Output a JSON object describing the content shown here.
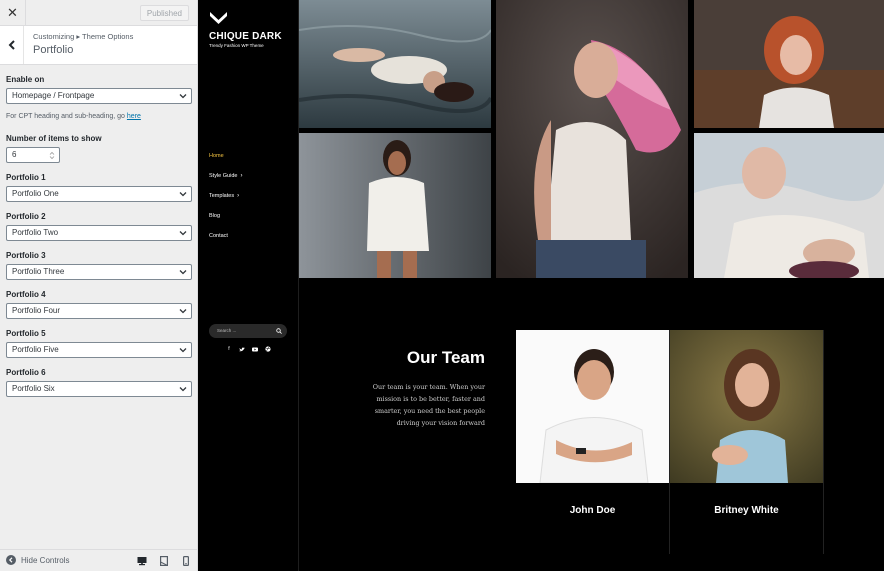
{
  "customizer": {
    "close_icon": "close-icon",
    "published_label": "Published",
    "breadcrumb": "Customizing ▸ Theme Options",
    "section_title": "Portfolio",
    "enable_on": {
      "label": "Enable on",
      "value": "Homepage / Frontpage"
    },
    "help": {
      "text": "For CPT heading and sub-heading, go ",
      "link": "here"
    },
    "items_count": {
      "label": "Number of items to show",
      "value": "6"
    },
    "portfolios": [
      {
        "label": "Portfolio 1",
        "value": "Portfolio One"
      },
      {
        "label": "Portfolio 2",
        "value": "Portfolio Two"
      },
      {
        "label": "Portfolio 3",
        "value": "Portfolio Three"
      },
      {
        "label": "Portfolio 4",
        "value": "Portfolio Four"
      },
      {
        "label": "Portfolio 5",
        "value": "Portfolio Five"
      },
      {
        "label": "Portfolio 6",
        "value": "Portfolio Six"
      }
    ],
    "footer": {
      "hide_controls": "Hide Controls"
    }
  },
  "site": {
    "title": "CHIQUE DARK",
    "tagline": "Trendy Fashion WP Theme",
    "menu": [
      {
        "label": "Home",
        "active": true
      },
      {
        "label": "Style Guide",
        "has_children": true
      },
      {
        "label": "Templates",
        "has_children": true
      },
      {
        "label": "Blog"
      },
      {
        "label": "Contact"
      }
    ],
    "search_placeholder": "Search ...",
    "social_icons": [
      "facebook-icon",
      "twitter-icon",
      "youtube-icon",
      "dribbble-icon"
    ]
  },
  "team": {
    "title": "Our Team",
    "text": "Our team is your team. When your mission is to be better, faster and smarter, you need the best people driving your vision forward",
    "members": [
      {
        "name": "John Doe"
      },
      {
        "name": "Britney White"
      }
    ]
  },
  "colors": {
    "accent": "#f5c542",
    "link": "#0073aa",
    "sidebar_bg": "#eeeeee",
    "preview_bg": "#000000"
  }
}
